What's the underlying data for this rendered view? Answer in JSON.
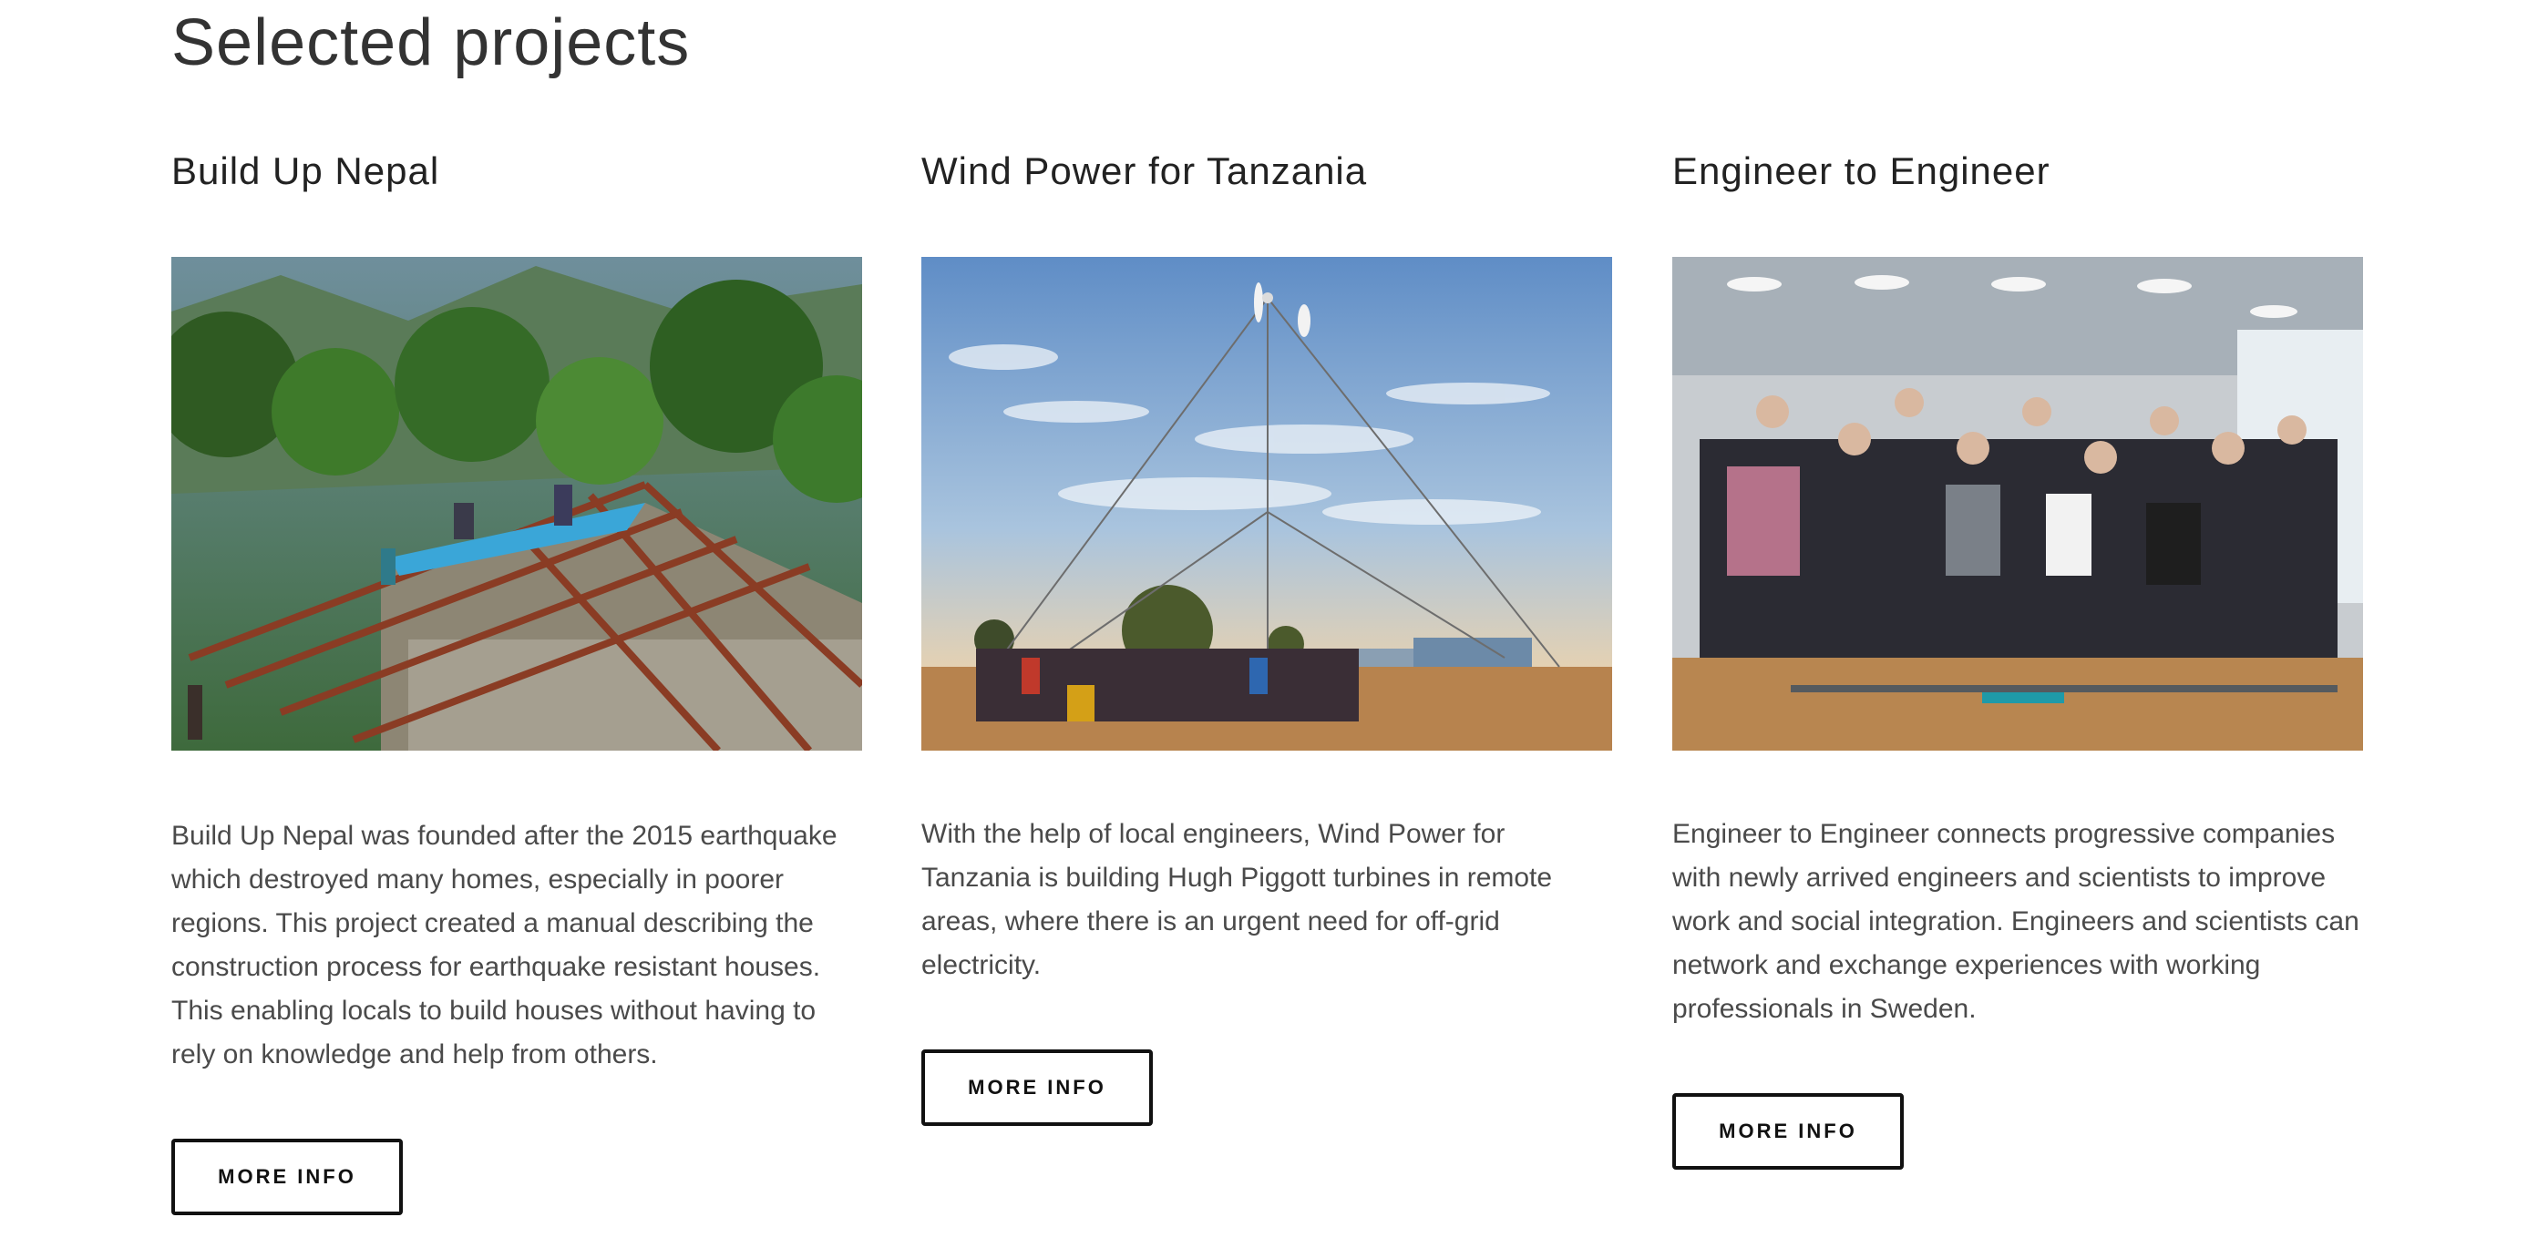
{
  "section": {
    "title": "Selected projects"
  },
  "projects": [
    {
      "title": "Build Up Nepal",
      "description": "Build Up Nepal was founded after the 2015 earthquake which destroyed many homes, especially in poorer regions. This project created a manual describing the construction process for earthquake resistant houses. This enabling locals to build houses without having to rely on knowledge and help from others.",
      "button_label": "MORE INFO"
    },
    {
      "title": "Wind Power for Tanzania",
      "description": "With the help of local engineers, Wind Power for Tanzania is building Hugh Piggott turbines in remote areas, where there is an urgent need for off-grid electricity.",
      "button_label": "MORE INFO"
    },
    {
      "title": "Engineer to Engineer",
      "description": "Engineer to Engineer connects progressive companies with newly arrived engineers and scientists to improve work and social integration. Engineers and scientists can network and exchange experiences with working professionals in Sweden.",
      "button_label": "MORE INFO"
    }
  ],
  "colors": {
    "text": "#333333",
    "button_border": "#111111",
    "background": "#ffffff"
  }
}
